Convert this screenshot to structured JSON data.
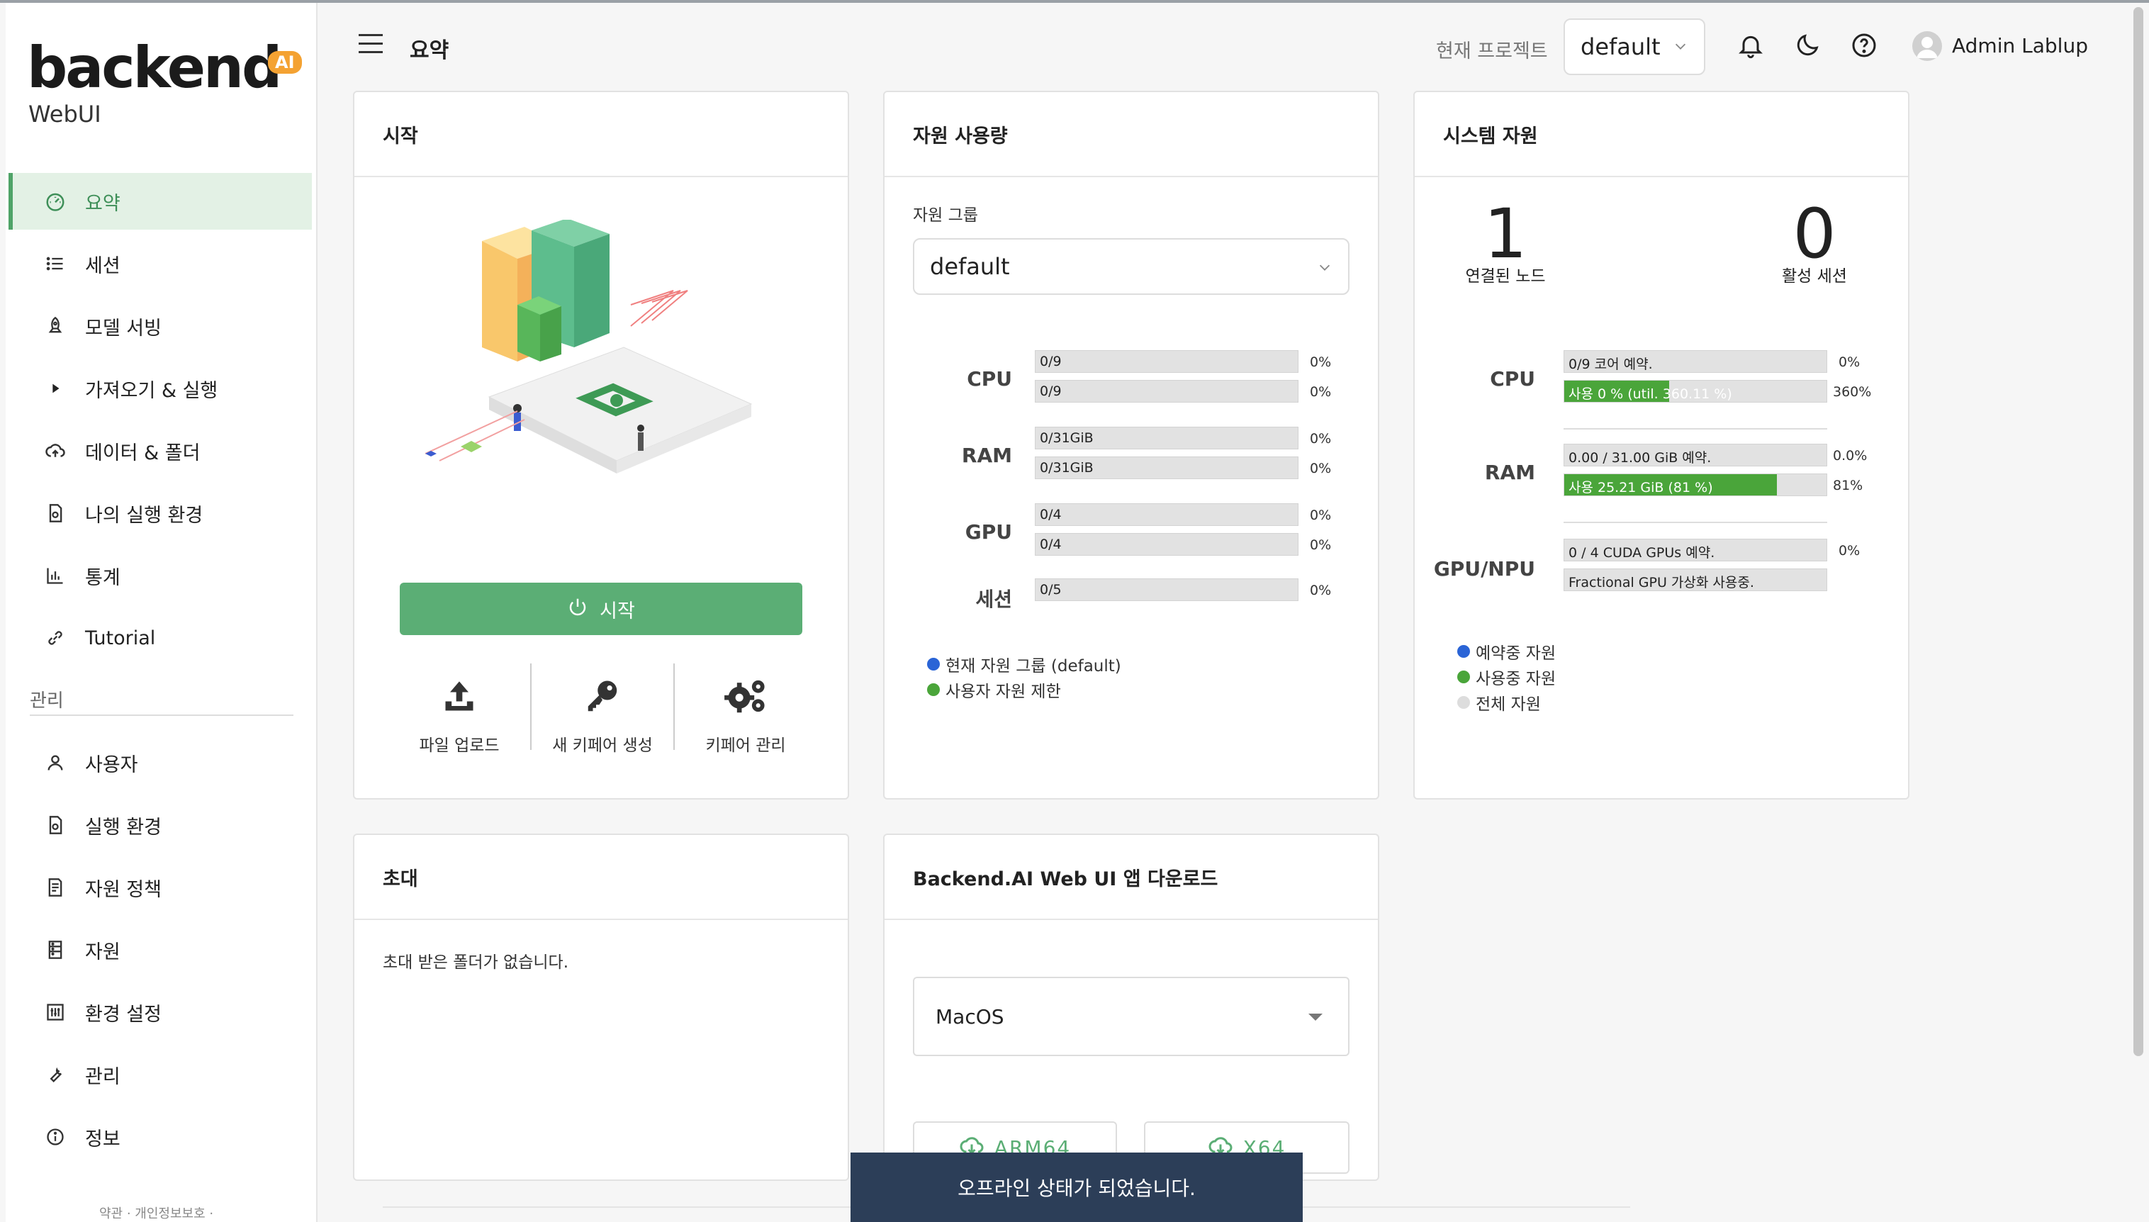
{
  "app": {
    "logo_text": "backend",
    "logo_badge": "AI",
    "logo_sub": "WebUI"
  },
  "sidebar": {
    "items": [
      {
        "label": "요약",
        "icon": "dashboard-icon",
        "active": true
      },
      {
        "label": "세션",
        "icon": "list-icon"
      },
      {
        "label": "모델 서빙",
        "icon": "rocket-icon"
      },
      {
        "label": "가져오기 & 실행",
        "icon": "play-icon"
      },
      {
        "label": "데이터 & 폴더",
        "icon": "cloud-upload-icon"
      },
      {
        "label": "나의 실행 환경",
        "icon": "file-settings-icon"
      },
      {
        "label": "통계",
        "icon": "bar-chart-icon"
      },
      {
        "label": "Tutorial",
        "icon": "link-icon"
      }
    ],
    "admin_section_label": "관리",
    "admin_items": [
      {
        "label": "사용자",
        "icon": "user-icon"
      },
      {
        "label": "실행 환경",
        "icon": "file-settings-icon"
      },
      {
        "label": "자원 정책",
        "icon": "policy-icon"
      },
      {
        "label": "자원",
        "icon": "server-icon"
      },
      {
        "label": "환경 설정",
        "icon": "sliders-icon"
      },
      {
        "label": "관리",
        "icon": "wrench-icon"
      },
      {
        "label": "정보",
        "icon": "info-icon"
      }
    ],
    "footer": "약관 · 개인정보보호 ·"
  },
  "header": {
    "title": "요약",
    "project_label": "현재 프로젝트",
    "project_value": "default",
    "user_name": "Admin Lablup"
  },
  "start_card": {
    "title": "시작",
    "start_button": "시작",
    "quick_actions": [
      {
        "label": "파일 업로드",
        "icon": "upload-icon"
      },
      {
        "label": "새 키페어 생성",
        "icon": "key-icon"
      },
      {
        "label": "키페어 관리",
        "icon": "gears-icon"
      }
    ]
  },
  "usage_card": {
    "title": "자원 사용량",
    "group_label": "자원 그룹",
    "group_value": "default",
    "resources": [
      {
        "name": "CPU",
        "bars": [
          {
            "text": "0/9",
            "pct": "0%"
          },
          {
            "text": "0/9",
            "pct": "0%"
          }
        ]
      },
      {
        "name": "RAM",
        "bars": [
          {
            "text": "0/31GiB",
            "pct": "0%"
          },
          {
            "text": "0/31GiB",
            "pct": "0%"
          }
        ]
      },
      {
        "name": "GPU",
        "bars": [
          {
            "text": "0/4",
            "pct": "0%"
          },
          {
            "text": "0/4",
            "pct": "0%"
          }
        ]
      },
      {
        "name": "세션",
        "bars": [
          {
            "text": "0/5",
            "pct": "0%"
          }
        ]
      }
    ],
    "legend": [
      {
        "label": "현재 자원 그룹 (default)",
        "color": "#2a64d6"
      },
      {
        "label": "사용자 자원 제한",
        "color": "#4aa53a"
      }
    ]
  },
  "system_card": {
    "title": "시스템 자원",
    "nodes_value": "1",
    "nodes_label": "연결된 노드",
    "sessions_value": "0",
    "sessions_label": "활성 세션",
    "cpu": {
      "name": "CPU",
      "reserved_text": "0/9 코어 예약.",
      "reserved_pct": "0%",
      "used_text": "사용 0 % (util. 360.11 %)",
      "used_pct": "360%",
      "used_fill": 0.4
    },
    "ram": {
      "name": "RAM",
      "reserved_text": "0.00 / 31.00 GiB 예약.",
      "reserved_pct": "0.0%",
      "used_text": "사용 25.21 GiB (81 %)",
      "used_pct": "81%",
      "used_fill": 0.81
    },
    "gpu": {
      "name": "GPU/NPU",
      "reserved_text": "0 / 4 CUDA GPUs 예약.",
      "reserved_pct": "0%",
      "note_text": "Fractional GPU 가상화 사용중."
    },
    "legend": [
      {
        "label": "예약중 자원",
        "color": "#2a64d6"
      },
      {
        "label": "사용중 자원",
        "color": "#4aa53a"
      },
      {
        "label": "전체 자원",
        "color": "#dddddd"
      }
    ]
  },
  "invite_card": {
    "title": "초대",
    "empty_text": "초대 받은 폴더가 없습니다."
  },
  "download_card": {
    "title": "Backend.AI Web UI 앱 다운로드",
    "os_value": "MacOS",
    "buttons": [
      "ARM64",
      "X64"
    ]
  },
  "toast": {
    "message": "오프라인 상태가 되었습니다."
  },
  "colors": {
    "accent": "#5bae75",
    "active_bg": "#e3f1e5",
    "blue": "#2a64d6",
    "green": "#4aa53a",
    "toast_bg": "#2c3e58"
  }
}
